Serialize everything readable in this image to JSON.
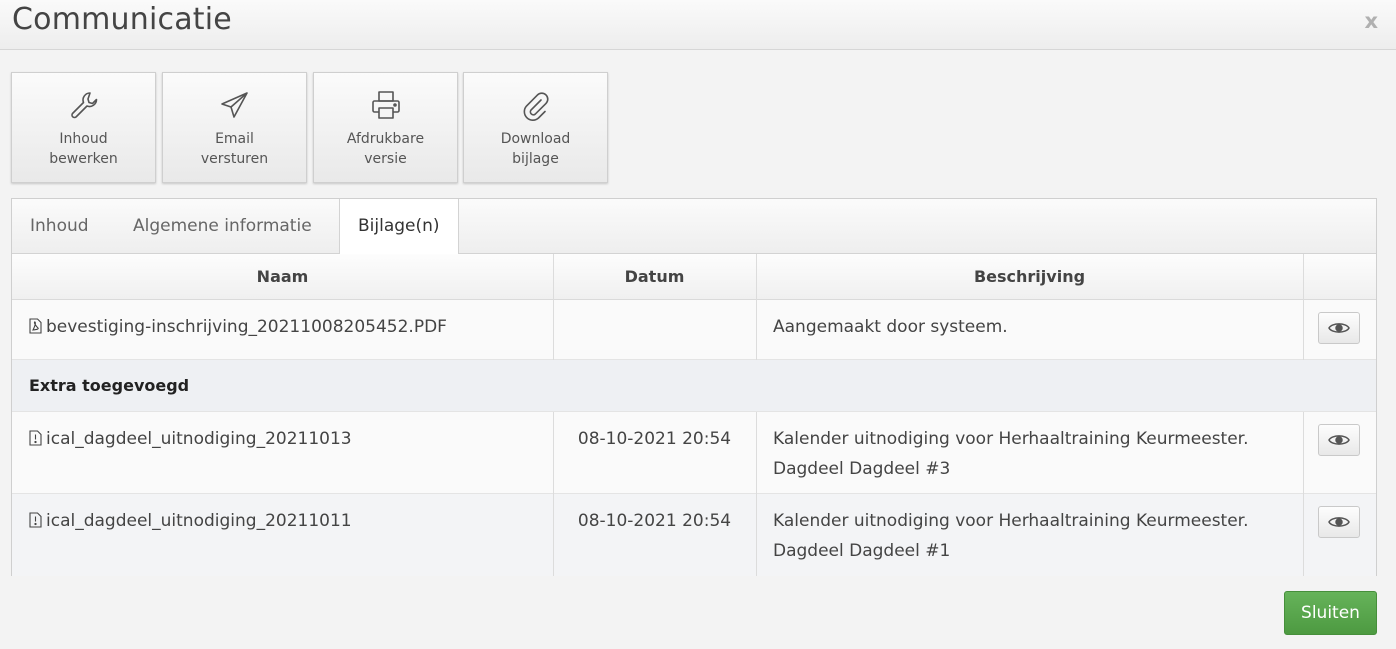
{
  "dialog": {
    "title": "Communicatie",
    "close_symbol": "x"
  },
  "toolbar": [
    {
      "icon": "wrench-icon",
      "line1": "Inhoud",
      "line2": "bewerken"
    },
    {
      "icon": "paper-plane-icon",
      "line1": "Email",
      "line2": "versturen"
    },
    {
      "icon": "printer-icon",
      "line1": "Afdrukbare",
      "line2": "versie"
    },
    {
      "icon": "paperclip-icon",
      "line1": "Download",
      "line2": "bijlage"
    }
  ],
  "tabs": [
    {
      "label": "Inhoud",
      "active": false
    },
    {
      "label": "Algemene informatie",
      "active": false
    },
    {
      "label": "Bijlage(n)",
      "active": true
    }
  ],
  "table": {
    "headers": [
      "Naam",
      "Datum",
      "Beschrijving",
      ""
    ],
    "rows": [
      {
        "icon": "pdf-file-icon",
        "naam": "bevestiging-inschrijving_20211008205452.PDF",
        "datum": "",
        "beschrijving_line1": "Aangemaakt door systeem.",
        "beschrijving_line2": ""
      }
    ],
    "group_label": "Extra toegevoegd",
    "group_rows": [
      {
        "icon": "alert-file-icon",
        "naam": "ical_dagdeel_uitnodiging_20211013",
        "datum": "08-10-2021 20:54",
        "beschrijving_line1": "Kalender uitnodiging voor Herhaaltraining Keurmeester.",
        "beschrijving_line2": "Dagdeel Dagdeel #3"
      },
      {
        "icon": "alert-file-icon",
        "naam": "ical_dagdeel_uitnodiging_20211011",
        "datum": "08-10-2021 20:54",
        "beschrijving_line1": "Kalender uitnodiging voor Herhaaltraining Keurmeester.",
        "beschrijving_line2": "Dagdeel Dagdeel #1"
      }
    ]
  },
  "footer": {
    "close_label": "Sluiten"
  },
  "colors": {
    "primary_green": "#5aa64e",
    "header_bg": "#ededed",
    "page_bg": "#f3f3f3"
  }
}
